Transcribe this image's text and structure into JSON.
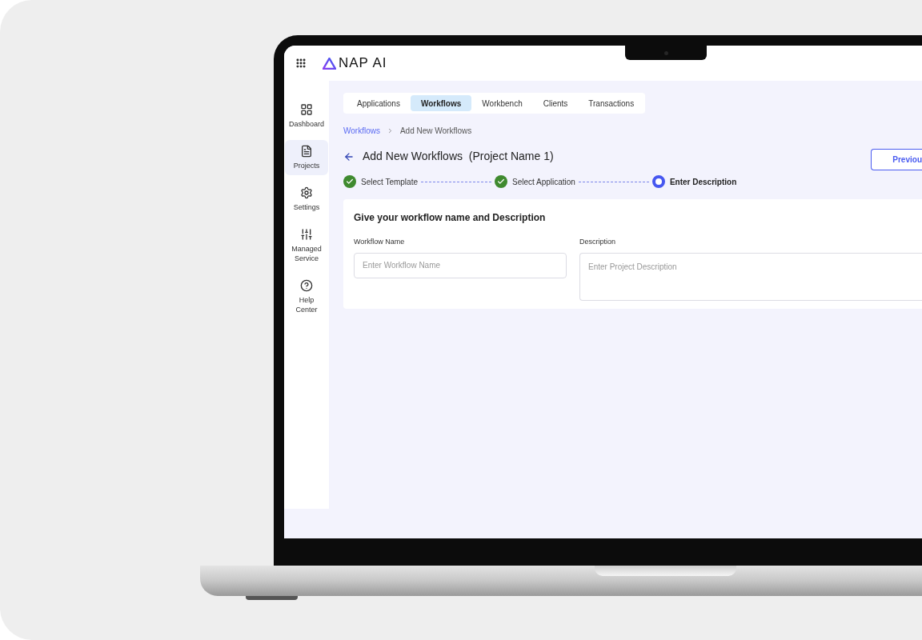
{
  "header": {
    "logo_text": "NAP AI"
  },
  "sidebar": {
    "items": [
      {
        "label": "Dashboard",
        "kind": "dashboard",
        "selected": false
      },
      {
        "label": "Projects",
        "kind": "projects",
        "selected": true
      },
      {
        "label": "Settings",
        "kind": "settings",
        "selected": false
      },
      {
        "label": "Managed Service",
        "kind": "service",
        "selected": false
      },
      {
        "label": "Help Center",
        "kind": "help",
        "selected": false
      }
    ]
  },
  "tabs": [
    {
      "label": "Applications",
      "selected": false
    },
    {
      "label": "Workflows",
      "selected": true
    },
    {
      "label": "Workbench",
      "selected": false
    },
    {
      "label": "Clients",
      "selected": false
    },
    {
      "label": "Transactions",
      "selected": false
    }
  ],
  "breadcrumb": [
    "Workflows",
    "Add New Workflows"
  ],
  "page_title": "Add New Workflows  (Project Name 1)",
  "steps": [
    {
      "label": "Select Template",
      "completed": true,
      "current": false
    },
    {
      "label": "Select Application",
      "completed": true,
      "current": false
    },
    {
      "label": "Enter Description",
      "completed": false,
      "current": true
    }
  ],
  "previous_button": "Previou",
  "form": {
    "title": "Give your workflow name and Description",
    "fields": [
      {
        "label": "Workflow Name",
        "placeholder": "Enter Workflow Name",
        "kind": "input"
      },
      {
        "label": "Description",
        "placeholder": "Enter Project Description",
        "kind": "textarea"
      }
    ]
  }
}
